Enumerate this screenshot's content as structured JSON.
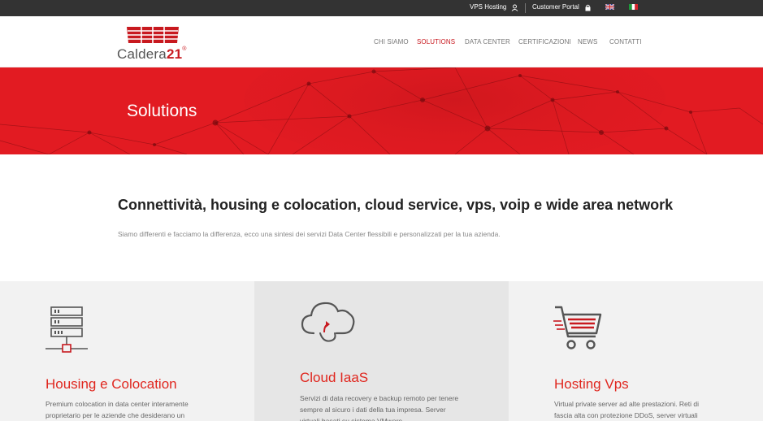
{
  "topbar": {
    "vps_hosting": "VPS Hosting",
    "customer_portal": "Customer Portal"
  },
  "brand": {
    "name": "Caldera",
    "number": "21",
    "registered": "®",
    "accent": "#c8191f"
  },
  "nav": [
    {
      "label": "CHI SIAMO"
    },
    {
      "label": "SOLUTIONS"
    },
    {
      "label": "DATA CENTER"
    },
    {
      "label": "CERTIFICAZIONI"
    },
    {
      "label": "NEWS"
    },
    {
      "label": "CONTATTI"
    }
  ],
  "hero": {
    "title": "Solutions",
    "background": "#e21b22"
  },
  "intro": {
    "title": "Connettività, housing e colocation, cloud service, vps, voip e wide area network",
    "text": "Siamo differenti e facciamo la differenza, ecco una sintesi dei servizi Data Center flessibili e personalizzati per la tua azienda."
  },
  "columns": [
    {
      "icon": "server-rack-icon",
      "title": "Housing e Colocation",
      "text": "Premium colocation in data center interamente proprietario per le aziende che desiderano un"
    },
    {
      "icon": "cloud-upload-icon",
      "title": "Cloud IaaS",
      "text": "Servizi di data recovery e backup remoto per tenere sempre al sicuro i dati della tua impresa. Server virtuali basati su sistema VMware"
    },
    {
      "icon": "shopping-cart-icon",
      "title": "Hosting Vps",
      "text": "Virtual private server ad alte prestazioni. Reti di fascia alta con protezione DDoS, server virtuali"
    }
  ]
}
